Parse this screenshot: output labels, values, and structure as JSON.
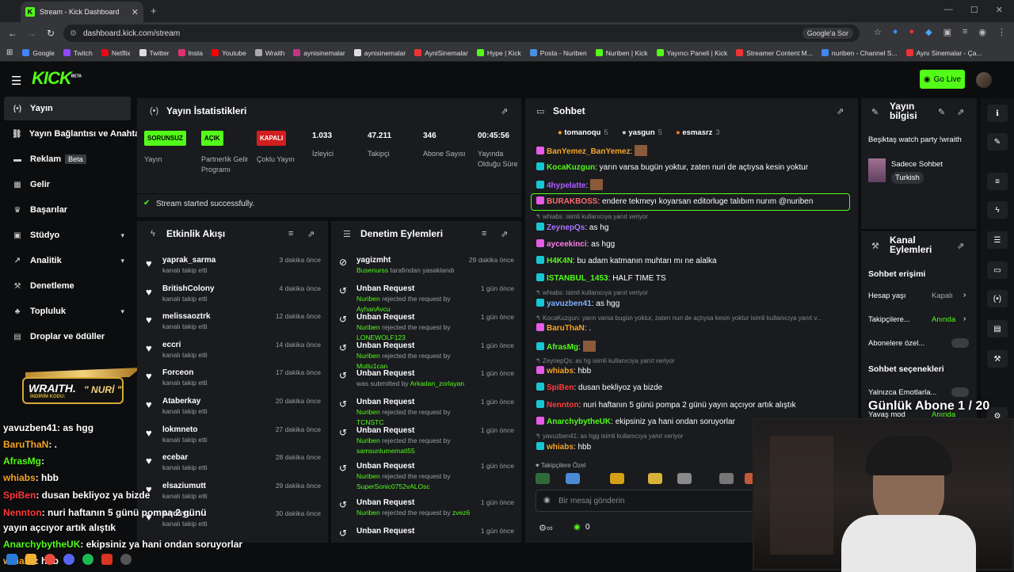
{
  "browser": {
    "tab_title": "Stream - Kick Dashboard",
    "url": "dashboard.kick.com/stream",
    "google_btn": "Google'a Sor",
    "bookmarks": [
      "Google",
      "Twitch",
      "Netflix",
      "Twitter",
      "Insta",
      "Youtube",
      "Wraith",
      "aynisinemalar",
      "aynisinemalar",
      "AyniSinemalar",
      "Hype | Kick",
      "Posta - Nuriben",
      "Nuriben | Kick",
      "Yayıncı Paneli | Kick",
      "Streamer Content M...",
      "nuriben - Channel S...",
      "Aynı Sinemalar - Ça..."
    ]
  },
  "header": {
    "logo": "KICK",
    "logo_sup": "BETA",
    "go_live": "Go Live"
  },
  "sidebar": {
    "items": [
      {
        "label": "Yayın",
        "icon": "broadcast-icon"
      },
      {
        "label": "Yayın Bağlantısı ve Anahtar",
        "icon": "link-icon"
      },
      {
        "label": "Reklam",
        "icon": "ad-icon",
        "badge": "Beta"
      },
      {
        "label": "Gelir",
        "icon": "money-icon"
      },
      {
        "label": "Başarılar",
        "icon": "trophy-icon"
      },
      {
        "label": "Stüdyo",
        "icon": "studio-icon"
      },
      {
        "label": "Analitik",
        "icon": "analytics-icon"
      },
      {
        "label": "Denetleme",
        "icon": "hammer-icon"
      },
      {
        "label": "Topluluk",
        "icon": "community-icon"
      },
      {
        "label": "Droplar ve ödüller",
        "icon": "gift-icon"
      }
    ]
  },
  "stats": {
    "title": "Yayın İstatistikleri",
    "items": [
      {
        "badge": "SORUNSUZ",
        "label": "Yayın"
      },
      {
        "badge": "AÇIK",
        "label": "Partnerlik Gelir Programı"
      },
      {
        "badge": "KAPALI",
        "label": "Çoklu Yayın"
      },
      {
        "value": "1.033",
        "label": "İzleyici"
      },
      {
        "value": "47.211",
        "label": "Takipçi"
      },
      {
        "value": "346",
        "label": "Abone Sayısı"
      },
      {
        "value": "00:45:56",
        "label": "Yayında Olduğu Süre"
      }
    ],
    "success": "Stream started successfully."
  },
  "activity": {
    "title": "Etkinlik Akışı",
    "rows": [
      {
        "name": "yaprak_sarma",
        "sub": "kanalı takip etti",
        "time": "3 dakika önce"
      },
      {
        "name": "BritishColony",
        "sub": "kanalı takip etti",
        "time": "4 dakika önce"
      },
      {
        "name": "melissaoztrk",
        "sub": "kanalı takip etti",
        "time": "12 dakika önce"
      },
      {
        "name": "eccri",
        "sub": "kanalı takip etti",
        "time": "14 dakika önce"
      },
      {
        "name": "Forceon",
        "sub": "kanalı takip etti",
        "time": "17 dakika önce"
      },
      {
        "name": "Ataberkay",
        "sub": "kanalı takip etti",
        "time": "20 dakika önce"
      },
      {
        "name": "lokmneto",
        "sub": "kanalı takip etti",
        "time": "27 dakika önce"
      },
      {
        "name": "ecebar",
        "sub": "kanalı takip etti",
        "time": "28 dakika önce"
      },
      {
        "name": "elsaziumutt",
        "sub": "kanalı takip etti",
        "time": "29 dakika önce"
      },
      {
        "name": "Aqdsyu",
        "sub": "kanalı takip etti",
        "time": "30 dakika önce"
      }
    ]
  },
  "moderation": {
    "title": "Denetim Eylemleri",
    "rows": [
      {
        "name": "yagizmht",
        "who": "Busenurss",
        "sub": "tarafından yasaklandı",
        "time": "29 dakika önce"
      },
      {
        "name": "Unban Request",
        "who": "Nuriben",
        "sub": "rejected the request by",
        "target": "AyhanAvcu",
        "time": "1 gün önce"
      },
      {
        "name": "Unban Request",
        "who": "Nuriben",
        "sub": "rejected the request by",
        "target": "LONEWOLF123",
        "time": "1 gün önce"
      },
      {
        "name": "Unban Request",
        "who": "Nuriben",
        "sub": "rejected the request by",
        "target": "Mutlu1can",
        "time": "1 gün önce"
      },
      {
        "name": "Unban Request",
        "who": "",
        "sub": "was submitted by",
        "target": "Arkadan_zorlayan",
        "time": "1 gün önce"
      },
      {
        "name": "Unban Request",
        "who": "Nuriben",
        "sub": "rejected the request by",
        "target": "TCNSTC",
        "time": "1 gün önce"
      },
      {
        "name": "Unban Request",
        "who": "Nuriben",
        "sub": "rejected the request by",
        "target": "samsunlumemati55",
        "time": "1 gün önce"
      },
      {
        "name": "Unban Request",
        "who": "Nuriben",
        "sub": "rejected the request by",
        "target": "SuperSonic0752vALOsc",
        "time": "1 gün önce"
      },
      {
        "name": "Unban Request",
        "who": "Nuriben",
        "sub": "rejected the request by",
        "target": "zvez6",
        "time": "1 gün önce"
      },
      {
        "name": "Unban Request",
        "who": "",
        "sub": "",
        "target": "",
        "time": "1 gün önce"
      }
    ]
  },
  "chat": {
    "title": "Sohbet",
    "top": [
      {
        "name": "tomanoqu",
        "n": "5"
      },
      {
        "name": "yasgun",
        "n": "5"
      },
      {
        "name": "esmasrz",
        "n": "3"
      }
    ],
    "messages": [
      {
        "user": "BanYemez_BanYemez",
        "color": "#f5a524",
        "text": ""
      },
      {
        "user": "KocaKuzgun",
        "color": "#53fc18",
        "text": "yarın varsa bugün yoktur, zaten nuri de açtıysa kesin yoktur"
      },
      {
        "user": "4hypelatte",
        "color": "#b05cff",
        "text": ""
      },
      {
        "user": "BURAKBOSS",
        "color": "#ff6b6b",
        "text": "endere tekmeyı koyarsan editorluge talıbım nurım @nuriben"
      },
      {
        "reply": "whiabs: isimli kullanıcıya yanıt veriyor"
      },
      {
        "user": "ZeynepQs",
        "color": "#a875ff",
        "text": "as hg"
      },
      {
        "user": "ayceekinci",
        "color": "#ff7de6",
        "text": "as hgg"
      },
      {
        "user": "H4K4N",
        "color": "#53fc18",
        "text": "bu adam katmanın muhtarı mı ne alalka"
      },
      {
        "user": "ISTANBUL_1453",
        "color": "#53fc18",
        "text": "HALF TIME TS"
      },
      {
        "reply": "whiabs: isimli kullanıcıya yanıt veriyor"
      },
      {
        "user": "yavuzben41",
        "color": "#7fb0ff",
        "text": "as hgg"
      },
      {
        "reply": "KocaKuzgun: yarın varsa bugün yoktur, zaten nuri de açtıysa kesin yoktur isimli kullanıcıya yanıt v..."
      },
      {
        "user": "BaruThaN",
        "color": "#f5a524",
        "text": "."
      },
      {
        "user": "AfrasMg",
        "color": "#53fc18",
        "text": ""
      },
      {
        "reply": "ZeynepQs: as hg isimli kullanıcıya yanıt veriyor"
      },
      {
        "user": "whiabs",
        "color": "#f5a524",
        "text": "hbb"
      },
      {
        "user": "SpiBen",
        "color": "#ff3b3b",
        "text": "dusan bekliyoz ya bizde"
      },
      {
        "user": "Nennton",
        "color": "#ff3b3b",
        "text": "nuri haftanın 5 günü pompa 2 günü yayın açcıyor artık alıştık"
      },
      {
        "user": "AnarchybytheUK",
        "color": "#53fc18",
        "text": "ekipsiniz ya hani ondan soruyorlar"
      },
      {
        "reply": "yavuzben41: as hgg isimli kullanıcıya yanıt veriyor"
      },
      {
        "user": "whiabs",
        "color": "#f5a524",
        "text": "hbb"
      }
    ],
    "followers_only": "Takipçilere Özel",
    "input_placeholder": "Bir mesaj gönderin",
    "points": "0"
  },
  "stream_info": {
    "title": "Yayın bilgisi",
    "stream_title": "Beşiktaş watch party !wraith",
    "category": "Sadece Sohbet",
    "tag": "Turkish"
  },
  "channel_actions": {
    "title": "Kanal Eylemleri",
    "section1": "Sohbet erişimi",
    "rows": [
      {
        "label": "Hesap yaşı",
        "value": "Kapalı"
      },
      {
        "label": "Takipçilere...",
        "value": "Anında"
      },
      {
        "label": "Abonelere özel...",
        "value": ""
      }
    ],
    "section2": "Sohbet seçenekleri",
    "rows2": [
      {
        "label": "Yalnızca Emotlarla...",
        "value": ""
      },
      {
        "label": "Yavaş mod",
        "value": "Anında"
      }
    ]
  },
  "overlay": {
    "sub_goal": "Günlük Abone 1 / 20",
    "wraith": "WRAITH.",
    "code_label": "İNDİRİM KODU:",
    "code": "\" NURİ \"",
    "chat": [
      {
        "user": "yavuzben41",
        "text": ": as hgg",
        "color": "#ffffff"
      },
      {
        "user": "BaruThaN",
        "text": ": .",
        "color": "#f5a524"
      },
      {
        "user": "AfrasMg",
        "text": ":",
        "color": "#53fc18"
      },
      {
        "user": "whiabs",
        "text": ": hbb",
        "color": "#f5a524"
      },
      {
        "user": "SpiBen",
        "text": ": dusan bekliyoz ya bizde",
        "color": "#ff3b3b"
      },
      {
        "user": "Nennton",
        "text": ": nuri haftanın 5 günü pompa 2 günü",
        "color": "#ff3b3b"
      },
      {
        "user": "",
        "text": "yayın açcıyor artık alıştık",
        "color": "#ffffff"
      },
      {
        "user": "AnarchybytheUK",
        "text": ": ekipsiniz ya hani ondan soruyorlar",
        "color": "#53fc18"
      },
      {
        "user": "whiabs",
        "text": ": hbb",
        "color": "#f5a524"
      }
    ]
  }
}
